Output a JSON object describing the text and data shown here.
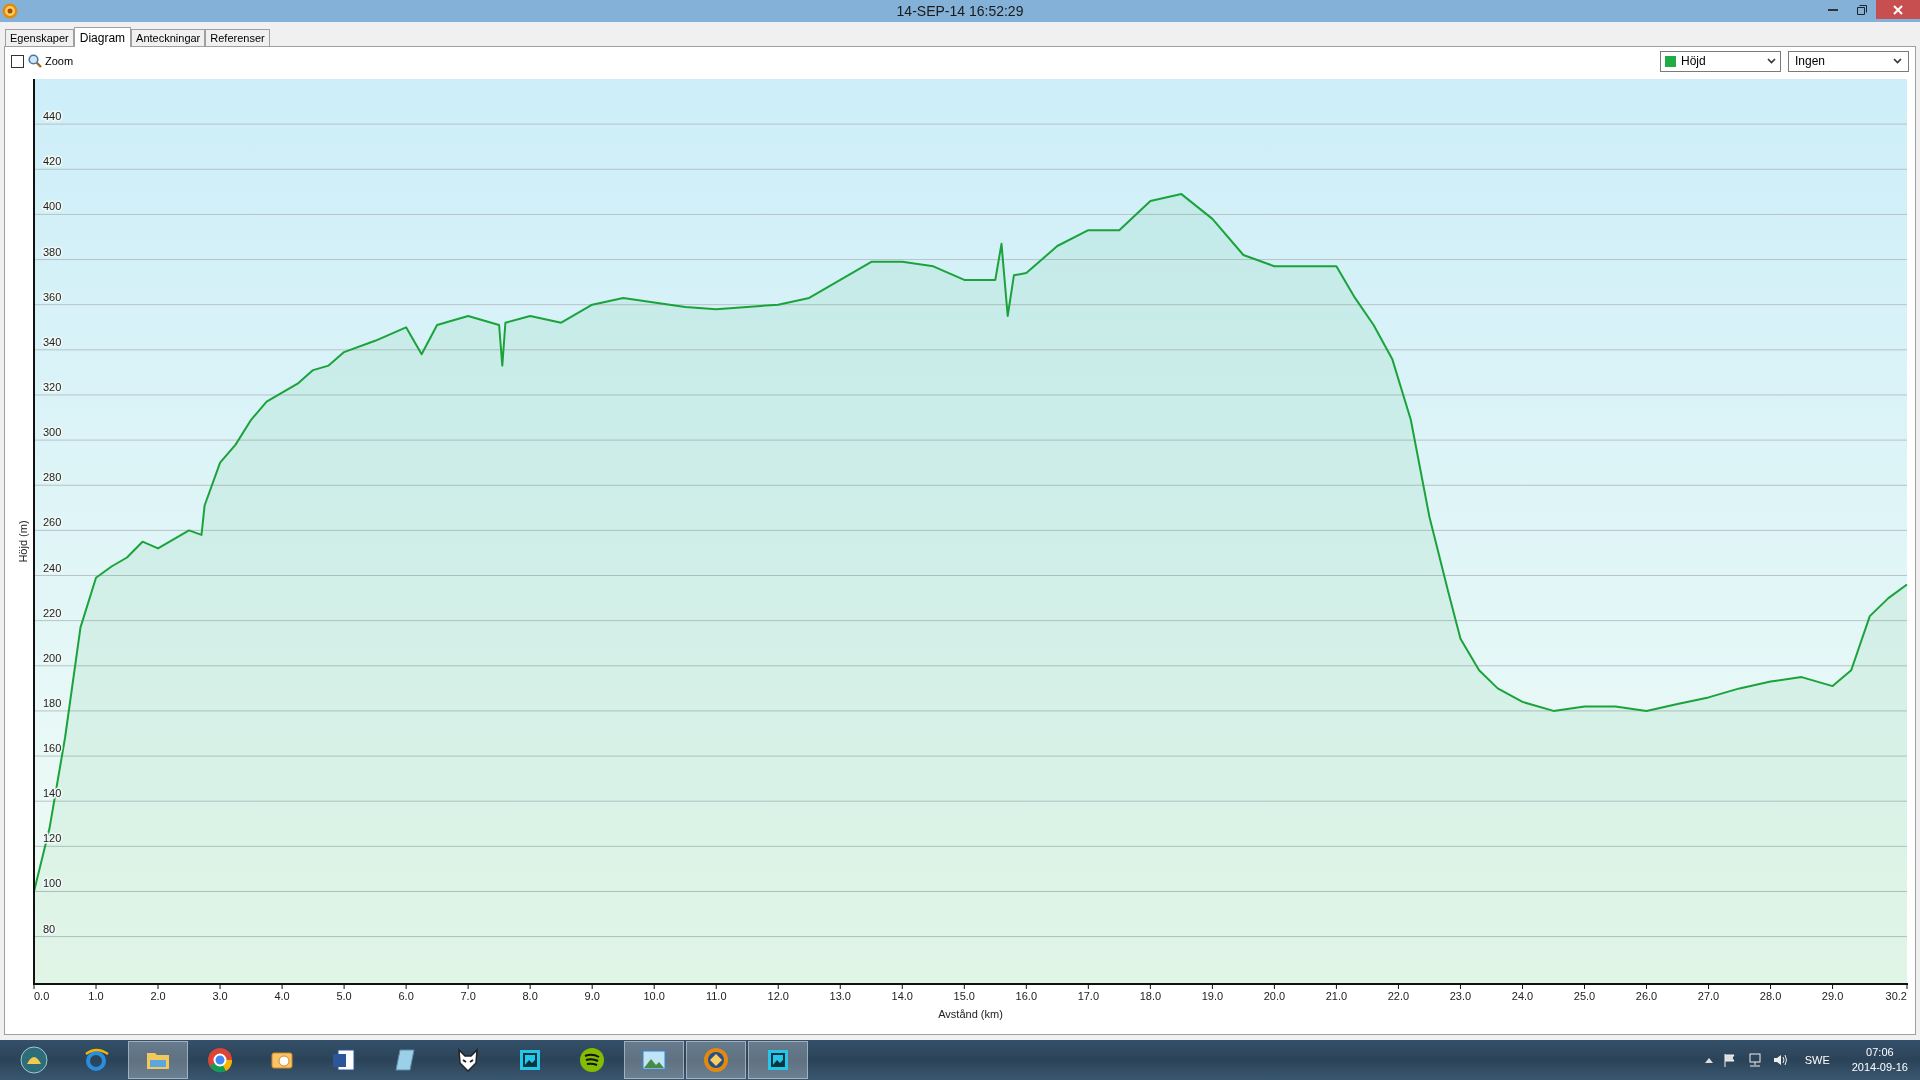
{
  "window": {
    "title": "14-SEP-14 16:52:29"
  },
  "tabs": [
    {
      "label": "Egenskaper",
      "selected": false
    },
    {
      "label": "Diagram",
      "selected": true
    },
    {
      "label": "Anteckningar",
      "selected": false
    },
    {
      "label": "Referenser",
      "selected": false
    }
  ],
  "toolbar": {
    "zoom": {
      "label": "Zoom",
      "checked": false
    },
    "series_dropdown": {
      "value": "Höjd",
      "color": "#22aa44"
    },
    "second_dropdown": {
      "value": "Ingen"
    }
  },
  "chart": {
    "chart_data": {
      "type": "area",
      "xlabel": "Avstånd (km)",
      "ylabel": "Höjd (m)",
      "xlim": [
        0,
        30.2
      ],
      "ylim": [
        59,
        460
      ],
      "grid": true,
      "xticks": [
        {
          "value": 0,
          "label": "0.0"
        },
        {
          "value": 1,
          "label": "1.0"
        },
        {
          "value": 2,
          "label": "2.0"
        },
        {
          "value": 3,
          "label": "3.0"
        },
        {
          "value": 4,
          "label": "4.0"
        },
        {
          "value": 5,
          "label": "5.0"
        },
        {
          "value": 6,
          "label": "6.0"
        },
        {
          "value": 7,
          "label": "7.0"
        },
        {
          "value": 8,
          "label": "8.0"
        },
        {
          "value": 9,
          "label": "9.0"
        },
        {
          "value": 10,
          "label": "10.0"
        },
        {
          "value": 11,
          "label": "11.0"
        },
        {
          "value": 12,
          "label": "12.0"
        },
        {
          "value": 13,
          "label": "13.0"
        },
        {
          "value": 14,
          "label": "14.0"
        },
        {
          "value": 15,
          "label": "15.0"
        },
        {
          "value": 16,
          "label": "16.0"
        },
        {
          "value": 17,
          "label": "17.0"
        },
        {
          "value": 18,
          "label": "18.0"
        },
        {
          "value": 19,
          "label": "19.0"
        },
        {
          "value": 20,
          "label": "20.0"
        },
        {
          "value": 21,
          "label": "21.0"
        },
        {
          "value": 22,
          "label": "22.0"
        },
        {
          "value": 23,
          "label": "23.0"
        },
        {
          "value": 24,
          "label": "24.0"
        },
        {
          "value": 25,
          "label": "25.0"
        },
        {
          "value": 26,
          "label": "26.0"
        },
        {
          "value": 27,
          "label": "27.0"
        },
        {
          "value": 28,
          "label": "28.0"
        },
        {
          "value": 29,
          "label": "29.0"
        },
        {
          "value": 30.2,
          "label": "30.2"
        }
      ],
      "yticks": [
        80,
        100,
        120,
        140,
        160,
        180,
        200,
        220,
        240,
        260,
        280,
        300,
        320,
        340,
        360,
        380,
        400,
        420,
        440
      ],
      "x": [
        0,
        0.25,
        0.5,
        0.75,
        1,
        1.25,
        1.5,
        1.75,
        2,
        2.25,
        2.5,
        2.7,
        2.75,
        3,
        3.25,
        3.5,
        3.75,
        4,
        4.25,
        4.5,
        4.75,
        5,
        5.5,
        6,
        6.25,
        6.5,
        7,
        7.5,
        7.55,
        7.6,
        8,
        8.5,
        9,
        9.5,
        10,
        10.5,
        11,
        11.5,
        12,
        12.5,
        13,
        13.5,
        14,
        14.5,
        15,
        15.5,
        15.6,
        15.7,
        15.8,
        16,
        16.5,
        17,
        17.5,
        18,
        18.5,
        19,
        19.5,
        20,
        20.5,
        21,
        21.3,
        21.6,
        21.9,
        22.2,
        22.5,
        22.8,
        23,
        23.3,
        23.6,
        24,
        24.5,
        25,
        25.5,
        26,
        26.5,
        27,
        27.5,
        28,
        28.5,
        29,
        29.3,
        29.6,
        29.9,
        30.2
      ],
      "series": [
        {
          "color": "#1aa33a",
          "values": [
            100,
            128,
            168,
            217,
            239,
            244,
            248,
            255,
            252,
            256,
            260,
            258,
            271,
            290,
            298,
            309,
            317,
            321,
            325,
            331,
            333,
            339,
            344,
            350,
            338,
            351,
            355,
            351,
            333,
            352,
            355,
            352,
            360,
            363,
            361,
            359,
            358,
            359,
            360,
            363,
            371,
            379,
            379,
            377,
            371,
            371,
            387,
            355,
            373,
            374,
            386,
            393,
            393,
            406,
            409,
            398,
            382,
            377,
            377,
            377,
            363,
            351,
            336,
            309,
            266,
            233,
            212,
            198,
            190,
            184,
            180,
            182,
            182,
            180,
            183,
            186,
            190,
            193,
            195,
            191,
            198,
            222,
            230,
            236
          ]
        }
      ]
    }
  },
  "taskbar": {
    "apps": [
      {
        "kind": "shell",
        "open": false
      },
      {
        "kind": "browser",
        "open": false
      },
      {
        "kind": "folder",
        "open": true
      },
      {
        "kind": "chrome",
        "open": false
      },
      {
        "kind": "mail",
        "open": false
      },
      {
        "kind": "word",
        "open": false
      },
      {
        "kind": "notepad",
        "open": false
      },
      {
        "kind": "fox",
        "open": false
      },
      {
        "kind": "photo",
        "open": false
      },
      {
        "kind": "music",
        "open": false
      },
      {
        "kind": "landscape",
        "open": true
      },
      {
        "kind": "target",
        "open": true
      },
      {
        "kind": "photo",
        "open": true
      }
    ],
    "language": "SWE",
    "time": "07:06",
    "date": "2014-09-16"
  }
}
